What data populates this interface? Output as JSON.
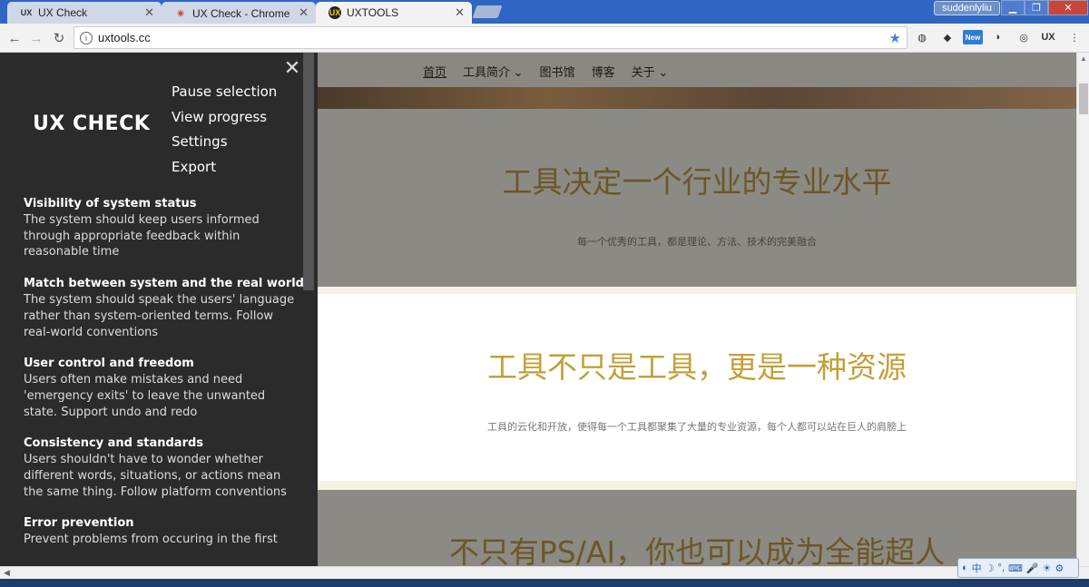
{
  "browser": {
    "tabs": [
      {
        "label": "UX Check",
        "icon": "UX",
        "active": false
      },
      {
        "label": "UX Check - Chrome 网",
        "icon": "chrome-store",
        "active": false
      },
      {
        "label": "UXTOOLS",
        "icon": "UX",
        "active": true
      }
    ],
    "user": "suddenlyliu",
    "url": "uxtools.cc",
    "extension_new_label": "New",
    "extension_ux_label": "UX"
  },
  "overlay": {
    "title": "UX CHECK",
    "menu": [
      "Pause selection",
      "View progress",
      "Settings",
      "Export"
    ],
    "heuristics": [
      {
        "title": "Visibility of system status",
        "desc": "The system should keep users informed through appropriate feedback within reasonable time"
      },
      {
        "title": "Match between system and the real world",
        "desc": "The system should speak the users' language rather than system-oriented terms. Follow real-world conventions"
      },
      {
        "title": "User control and freedom",
        "desc": "Users often make mistakes and need 'emergency exits' to leave the unwanted state. Support undo and redo"
      },
      {
        "title": "Consistency and standards",
        "desc": "Users shouldn't have to wonder whether different words, situations, or actions mean the same thing. Follow platform conventions"
      },
      {
        "title": "Error prevention",
        "desc": "Prevent problems from occuring in the first"
      }
    ]
  },
  "site": {
    "nav": [
      "首页",
      "工具简介",
      "图书馆",
      "博客",
      "关于"
    ],
    "sections": [
      {
        "heading": "工具决定一个行业的专业水平",
        "sub": "每一个优秀的工具，都是理论、方法、技术的完美融合"
      },
      {
        "heading": "工具不只是工具，更是一种资源",
        "sub": "工具的云化和开放，使得每一个工具都聚集了大量的专业资源，每个人都可以站在巨人的肩膀上"
      },
      {
        "heading": "不只有PS/AI，你也可以成为全能超人",
        "sub": ""
      }
    ]
  },
  "colors": {
    "overlay_bg": "#2b2b2b",
    "accent_gold": "#c2a03a",
    "section_gray": "#8c8a84"
  }
}
